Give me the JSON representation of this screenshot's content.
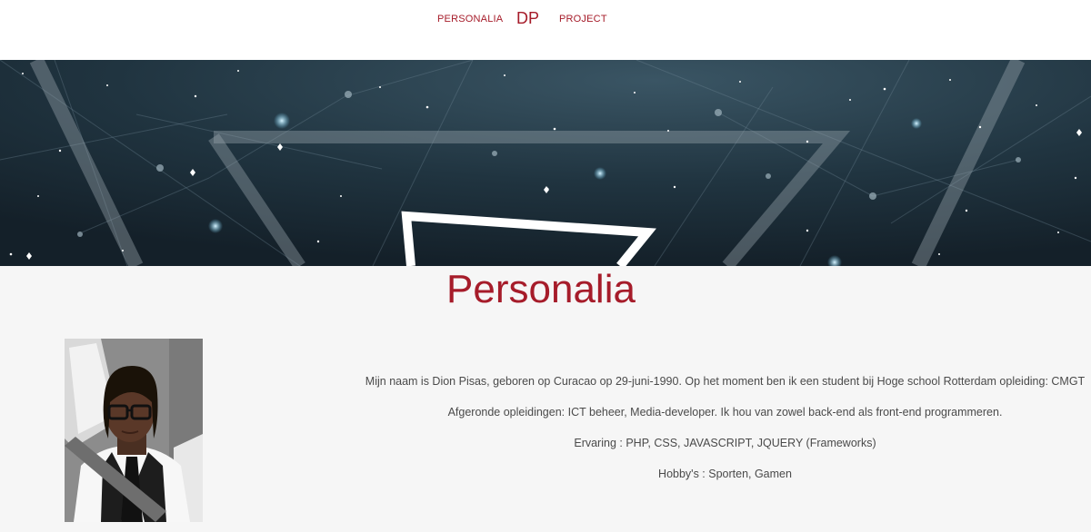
{
  "nav": {
    "personalia_label": "PERSONALIA",
    "logo_text": "DP",
    "project_label": "PROJECT"
  },
  "main": {
    "title": "Personalia",
    "bio": [
      "Mijn naam is Dion Pisas, geboren op Curacao op 29-juni-1990. Op het moment ben ik een student bij Hoge school Rotterdam opleiding: CMGT",
      "Afgeronde opleidingen: ICT beheer, Media-developer. Ik hou van zowel back-end als front-end programmeren.",
      "Ervaring : PHP, CSS, JAVASCRIPT, JQUERY (Frameworks)",
      "Hobby's : Sporten, Gamen"
    ]
  },
  "colors": {
    "accent": "#a61c2a",
    "hero_bg": "#1b2a33",
    "page_bg": "#f6f6f6",
    "text": "#4a4a4a"
  }
}
